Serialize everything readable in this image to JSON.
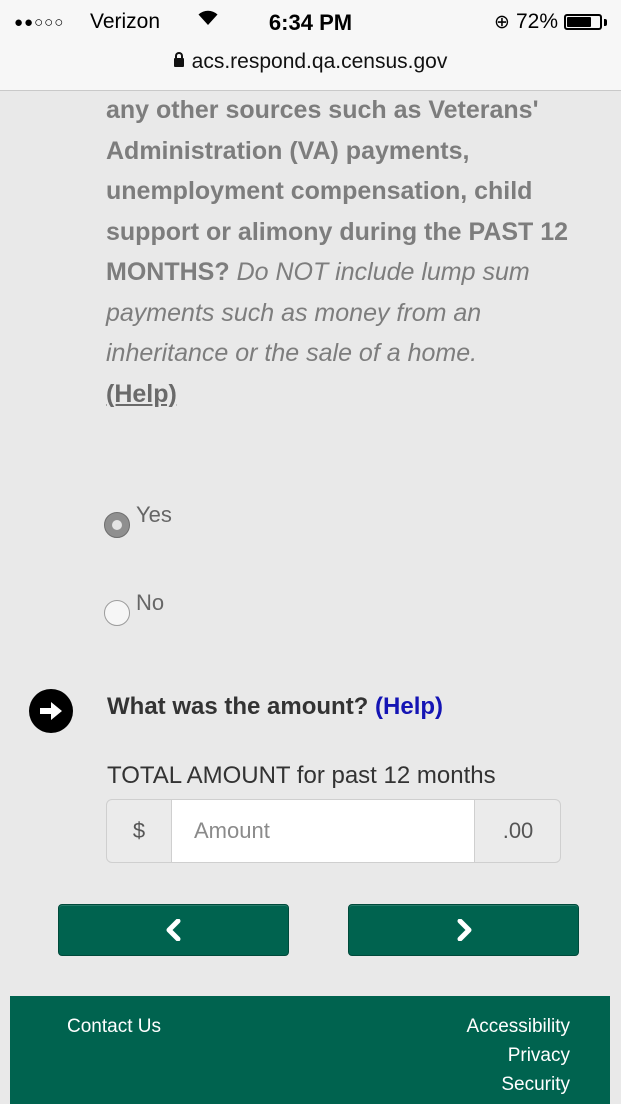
{
  "status_bar": {
    "signal": "●●○○○",
    "carrier": "Verizon",
    "time": "6:34 PM",
    "battery_percent": "72%",
    "battery_level": 0.72
  },
  "browser": {
    "url": "acs.respond.qa.census.gov"
  },
  "question": {
    "bold_text": "any other sources such as Veterans' Administration (VA) payments, unemployment compensation, child support or alimony during the PAST 12 MONTHS?",
    "italic_text": "Do NOT include lump sum payments such as money from an inheritance or the sale of a home.",
    "help_label": "(Help)",
    "options": [
      {
        "label": "Yes",
        "selected": true
      },
      {
        "label": "No",
        "selected": false
      }
    ]
  },
  "amount": {
    "question": "What was the amount?",
    "help_label": "(Help)",
    "total_label": "TOTAL AMOUNT for past 12 months",
    "prefix": "$",
    "placeholder": "Amount",
    "value": "",
    "suffix": ".00"
  },
  "nav": {
    "prev_icon": "chevron-left-icon",
    "next_icon": "chevron-right-icon"
  },
  "footer": {
    "contact": "Contact Us",
    "accessibility": "Accessibility",
    "privacy": "Privacy",
    "security": "Security"
  },
  "colors": {
    "brand_green": "#00634f",
    "help_link": "#1414b4"
  }
}
